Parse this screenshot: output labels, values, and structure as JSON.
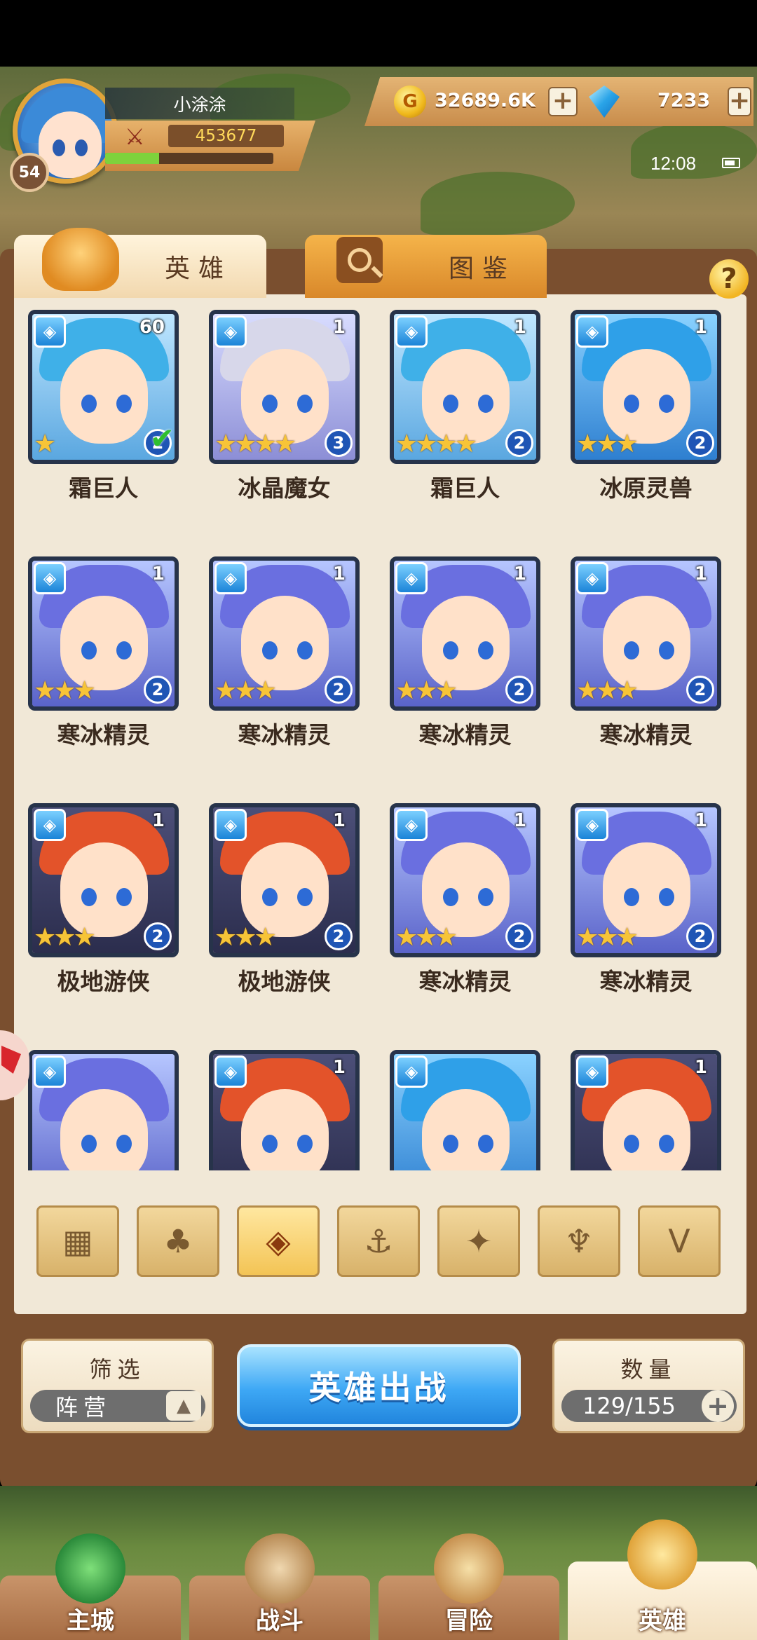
{
  "player": {
    "name": "小涂涂",
    "level": "54",
    "power": "453677",
    "xp_fraction": 0.32
  },
  "currency": {
    "gold": "32689.6K",
    "gems": "7233"
  },
  "status": {
    "time": "12:08"
  },
  "tabs": [
    {
      "label": "英雄",
      "active": true
    },
    {
      "label": "图鉴",
      "active": false
    }
  ],
  "heroes": [
    {
      "name": "霜巨人",
      "level": "60",
      "stars": "★",
      "rank": "2",
      "checked": true,
      "theme": "giant"
    },
    {
      "name": "冰晶魔女",
      "level": "1",
      "stars": "★★★★",
      "rank": "3",
      "checked": false,
      "theme": "witch"
    },
    {
      "name": "霜巨人",
      "level": "1",
      "stars": "★★★★",
      "rank": "2",
      "checked": false,
      "theme": "giant"
    },
    {
      "name": "冰原灵兽",
      "level": "1",
      "stars": "★★★",
      "rank": "2",
      "checked": false,
      "theme": "beast"
    },
    {
      "name": "寒冰精灵",
      "level": "1",
      "stars": "★★★",
      "rank": "2",
      "checked": false,
      "theme": "elf"
    },
    {
      "name": "寒冰精灵",
      "level": "1",
      "stars": "★★★",
      "rank": "2",
      "checked": false,
      "theme": "elf"
    },
    {
      "name": "寒冰精灵",
      "level": "1",
      "stars": "★★★",
      "rank": "2",
      "checked": false,
      "theme": "elf"
    },
    {
      "name": "寒冰精灵",
      "level": "1",
      "stars": "★★★",
      "rank": "2",
      "checked": false,
      "theme": "elf"
    },
    {
      "name": "极地游侠",
      "level": "1",
      "stars": "★★★",
      "rank": "2",
      "checked": false,
      "theme": "ranger"
    },
    {
      "name": "极地游侠",
      "level": "1",
      "stars": "★★★",
      "rank": "2",
      "checked": false,
      "theme": "ranger"
    },
    {
      "name": "寒冰精灵",
      "level": "1",
      "stars": "★★★",
      "rank": "2",
      "checked": false,
      "theme": "elf"
    },
    {
      "name": "寒冰精灵",
      "level": "1",
      "stars": "★★★",
      "rank": "2",
      "checked": false,
      "theme": "elf"
    },
    {
      "name": "",
      "level": "",
      "stars": "",
      "rank": "",
      "checked": false,
      "theme": "elf"
    },
    {
      "name": "",
      "level": "1",
      "stars": "",
      "rank": "",
      "checked": false,
      "theme": "ranger"
    },
    {
      "name": "",
      "level": "",
      "stars": "",
      "rank": "",
      "checked": false,
      "theme": "beast"
    },
    {
      "name": "",
      "level": "1",
      "stars": "",
      "rank": "",
      "checked": false,
      "theme": "ranger"
    }
  ],
  "filters": [
    {
      "icon": "grid-icon",
      "glyph": "▦",
      "selected": false
    },
    {
      "icon": "leaf-icon",
      "glyph": "♣",
      "selected": false
    },
    {
      "icon": "ice-crystal-icon",
      "glyph": "◈",
      "selected": true
    },
    {
      "icon": "anchor-icon",
      "glyph": "⚓",
      "selected": false
    },
    {
      "icon": "beast-head-icon",
      "glyph": "✦",
      "selected": false
    },
    {
      "icon": "fang-icon",
      "glyph": "♆",
      "selected": false
    },
    {
      "icon": "v-wing-icon",
      "glyph": "V",
      "selected": false
    }
  ],
  "filter_panel": {
    "title": "筛选",
    "value": "阵营"
  },
  "deploy_button": "英雄出战",
  "count_panel": {
    "title": "数量",
    "value": "129/155"
  },
  "bottom_nav": [
    {
      "label": "主城",
      "active": false
    },
    {
      "label": "战斗",
      "active": false
    },
    {
      "label": "冒险",
      "active": false
    },
    {
      "label": "英雄",
      "active": true
    }
  ],
  "colors": {
    "accent": "#3ea8f5",
    "gold": "#f0b91c",
    "frame": "#7a4f2f",
    "page": "#f1e8d7"
  }
}
